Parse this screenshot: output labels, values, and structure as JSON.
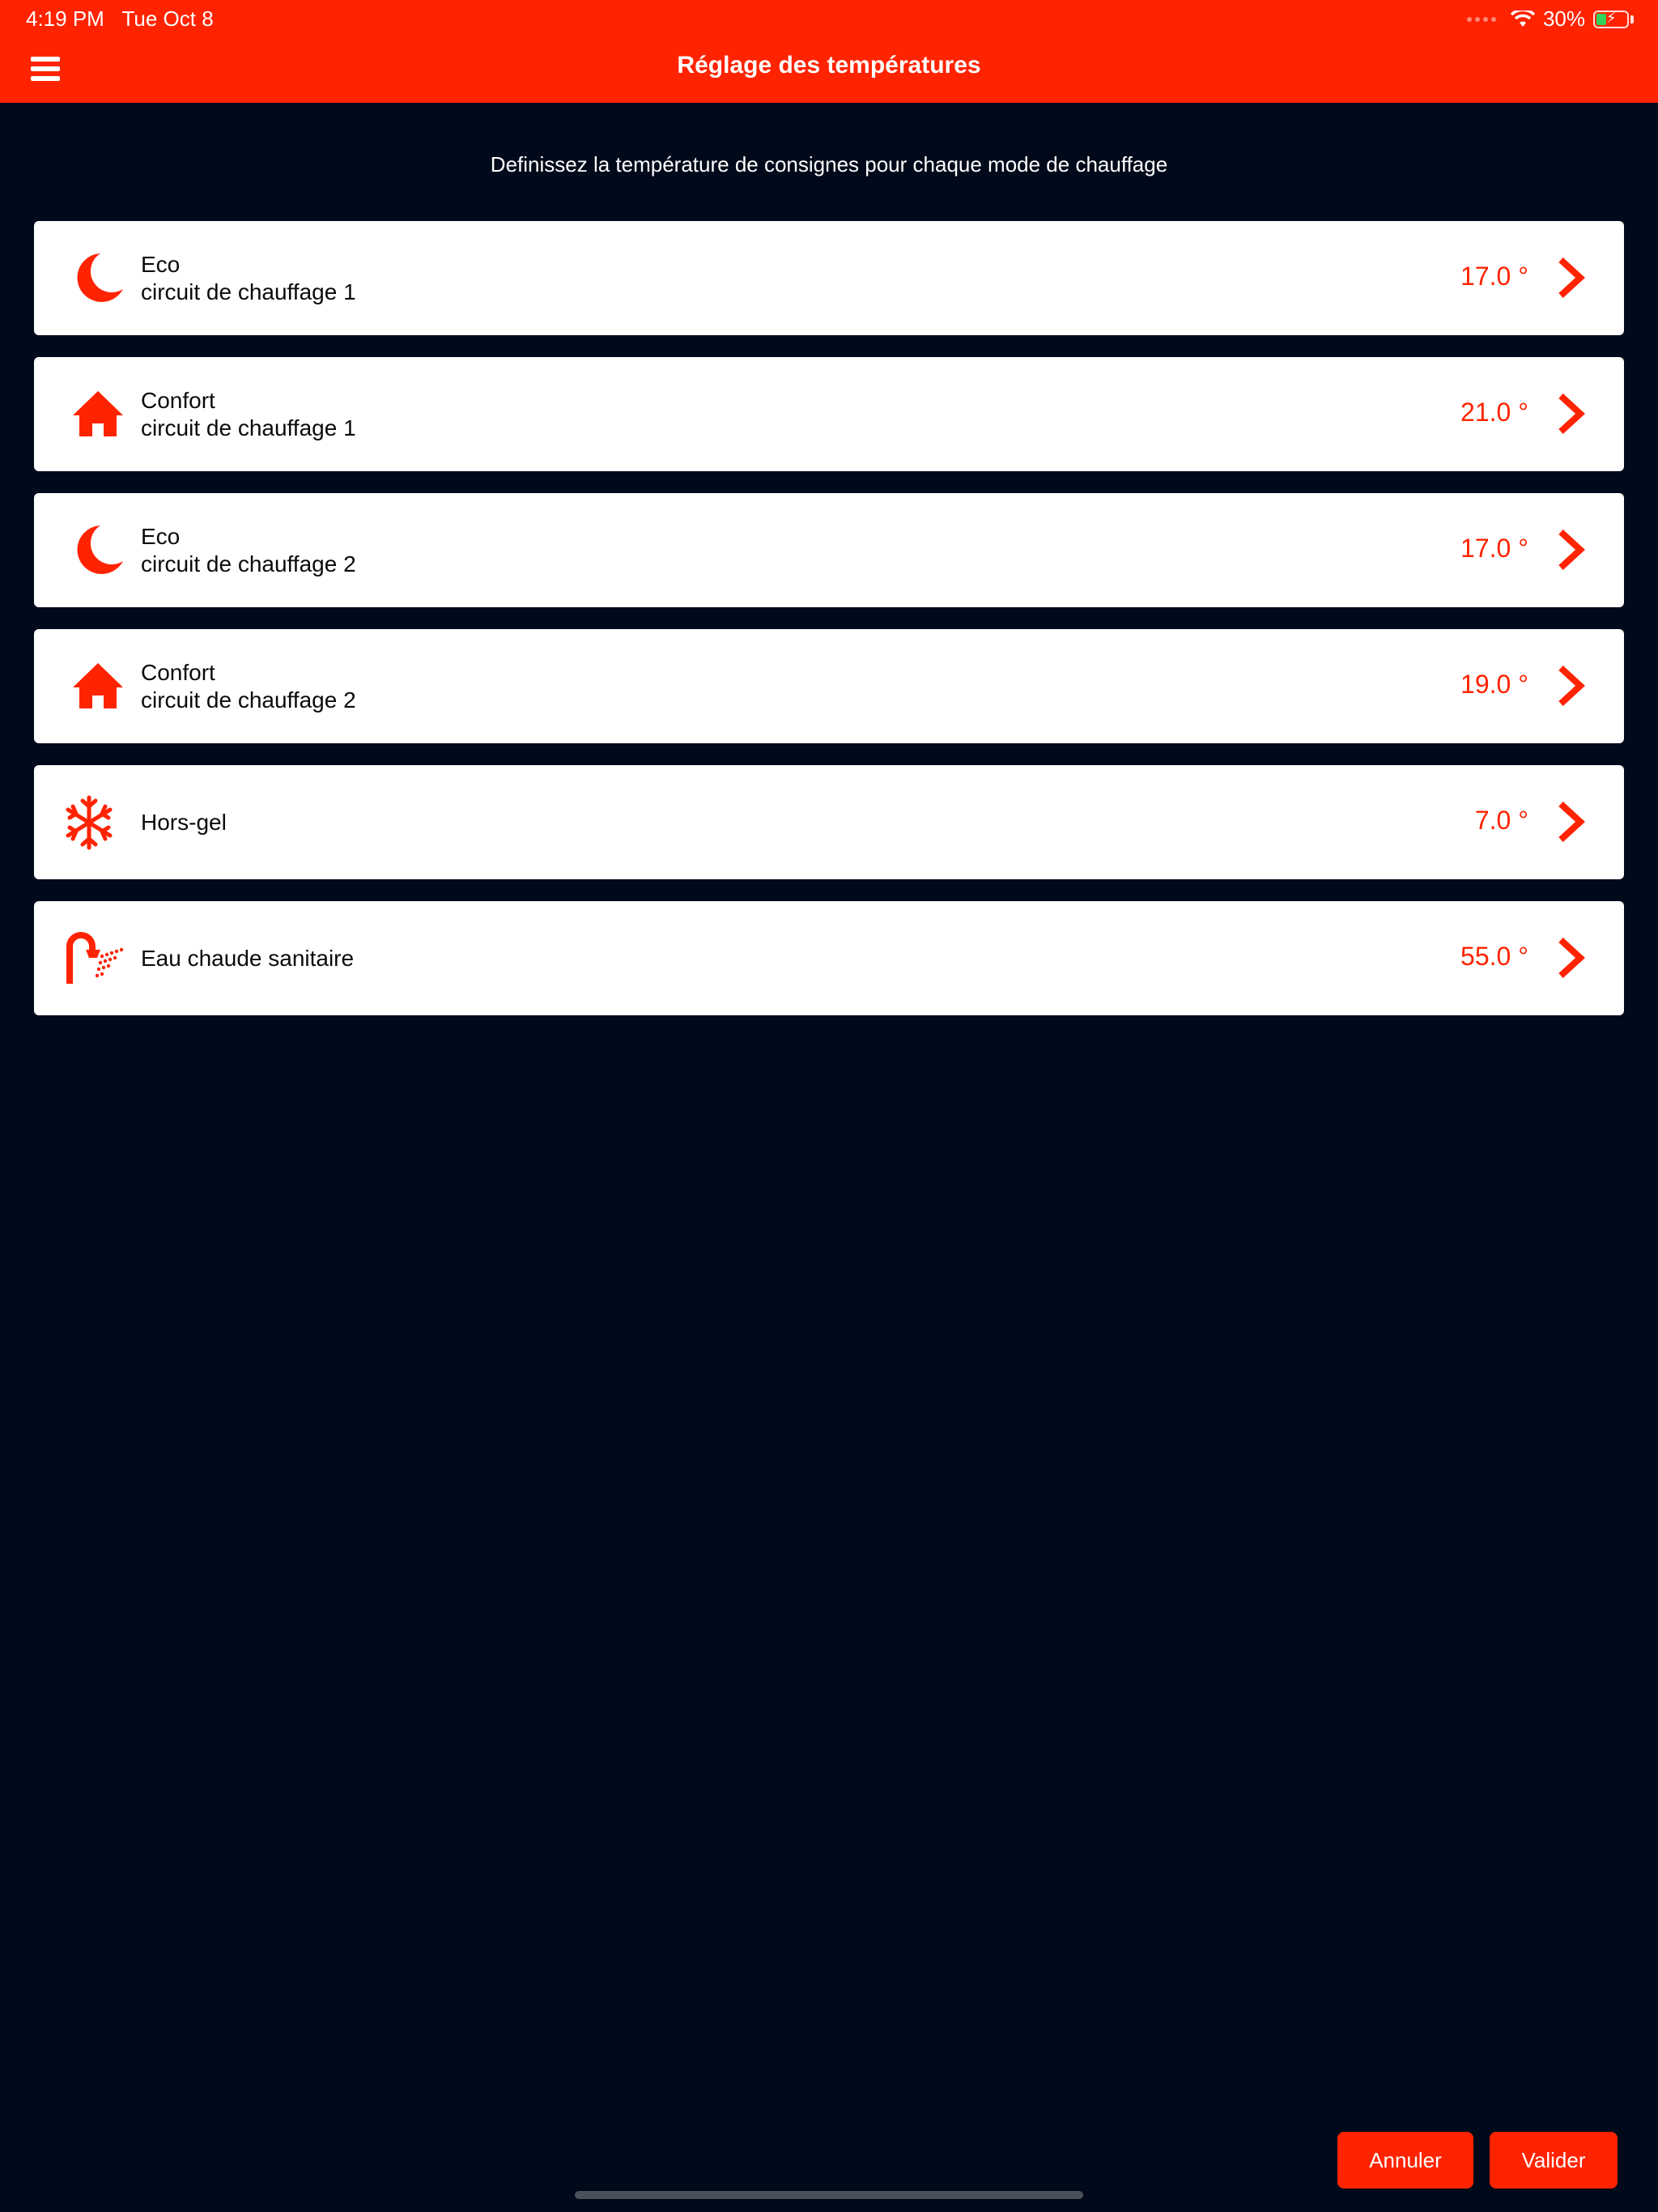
{
  "status": {
    "time": "4:19 PM",
    "date": "Tue Oct 8",
    "battery": "30%"
  },
  "header": {
    "title": "Réglage des températures"
  },
  "subtitle": "Definissez la température de consignes pour chaque mode de chauffage",
  "rows": [
    {
      "icon": "moon-icon",
      "line1": "Eco",
      "line2": "circuit de chauffage 1",
      "value": "17.0 °"
    },
    {
      "icon": "house-icon",
      "line1": "Confort",
      "line2": "circuit de chauffage 1",
      "value": "21.0 °"
    },
    {
      "icon": "moon-icon",
      "line1": "Eco",
      "line2": "circuit de chauffage 2",
      "value": "17.0 °"
    },
    {
      "icon": "house-icon",
      "line1": "Confort",
      "line2": "circuit de chauffage 2",
      "value": "19.0 °"
    },
    {
      "icon": "snowflake-icon",
      "line1": "Hors-gel",
      "line2": "",
      "value": "7.0 °"
    },
    {
      "icon": "shower-icon",
      "line1": "Eau chaude sanitaire",
      "line2": "",
      "value": "55.0 °"
    }
  ],
  "footer": {
    "cancel_label": "Annuler",
    "ok_label": "Valider"
  },
  "colors": {
    "accent": "#ff2300",
    "background": "#010a1a",
    "card": "#ffffff"
  }
}
